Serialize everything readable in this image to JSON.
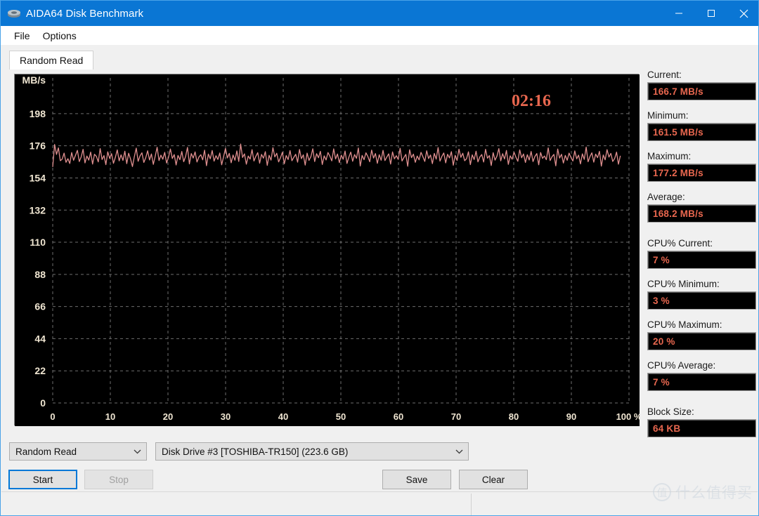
{
  "window": {
    "title": "AIDA64 Disk Benchmark",
    "icon": "disk-drive-icon",
    "minimize_label": "─",
    "maximize_label": "□",
    "close_label": "✕"
  },
  "menu": {
    "items": [
      {
        "label": "File"
      },
      {
        "label": "Options"
      }
    ]
  },
  "tabs": [
    {
      "label": "Random Read",
      "selected": true
    }
  ],
  "chart_data": {
    "type": "line",
    "title": "",
    "timer": "02:16",
    "xlabel": "",
    "ylabel": "MB/s",
    "x_unit": "%",
    "xlim": [
      0,
      100
    ],
    "ylim": [
      0,
      209
    ],
    "x_ticks": [
      0,
      10,
      20,
      30,
      40,
      50,
      60,
      70,
      80,
      90,
      100
    ],
    "x_tick_labels": [
      "0",
      "10",
      "20",
      "30",
      "40",
      "50",
      "60",
      "70",
      "80",
      "90",
      "100 %"
    ],
    "y_ticks": [
      0,
      22,
      44,
      66,
      88,
      110,
      132,
      154,
      176,
      198
    ],
    "y_tick_labels": [
      "0",
      "22",
      "44",
      "66",
      "88",
      "110",
      "132",
      "154",
      "176",
      "198"
    ],
    "grid": true,
    "grid_style": "dashed",
    "background_color": "#000000",
    "grid_color": "#6e6e6e",
    "tick_label_color": "#f0e6d2",
    "series": [
      {
        "name": "Random Read",
        "color": "#e09090",
        "unit": "MB/s",
        "x_end_percent": 98.5,
        "values": [
          161.5,
          176.9,
          170.1,
          174.6,
          165.8,
          166.9,
          171.0,
          164.7,
          167.2,
          163.9,
          171.4,
          166.1,
          169.5,
          172.9,
          165.2,
          168.4,
          173.6,
          164.3,
          169.0,
          166.2,
          171.7,
          163.5,
          170.2,
          168.8,
          165.0,
          174.1,
          166.6,
          169.3,
          163.1,
          171.9,
          167.4,
          170.6,
          164.0,
          168.1,
          173.2,
          165.7,
          169.8,
          166.0,
          172.3,
          163.8,
          170.9,
          167.0,
          161.8,
          168.6,
          174.4,
          165.4,
          169.1,
          171.2,
          164.6,
          167.8,
          172.6,
          166.3,
          170.4,
          163.3,
          168.9,
          175.0,
          165.9,
          169.6,
          166.8,
          171.5,
          164.2,
          168.2,
          173.8,
          167.3,
          170.0,
          162.9,
          169.4,
          166.5,
          172.1,
          165.1,
          168.7,
          174.9,
          163.6,
          170.7,
          167.6,
          171.8,
          164.9,
          168.3,
          169.9,
          166.4,
          173.0,
          162.4,
          170.3,
          167.1,
          172.8,
          165.5,
          169.2,
          166.7,
          171.1,
          163.0,
          168.5,
          174.2,
          167.7,
          170.8,
          164.4,
          169.7,
          166.1,
          172.5,
          165.3,
          177.2,
          168.0,
          170.5,
          163.4,
          169.0,
          166.9,
          173.4,
          165.6,
          168.8,
          171.3,
          164.1,
          170.1,
          167.5,
          172.0,
          162.6,
          169.5,
          166.2,
          174.7,
          168.4,
          170.9,
          165.0,
          167.9,
          171.6,
          163.7,
          169.3,
          166.6,
          172.7,
          165.8,
          168.1,
          170.2,
          164.8,
          173.5,
          167.2,
          169.8,
          162.8,
          171.0,
          166.0,
          168.6,
          174.0,
          165.2,
          170.6,
          167.8,
          172.2,
          163.2,
          169.1,
          166.3,
          171.4,
          168.9,
          165.7,
          173.9,
          167.0,
          170.4,
          164.5,
          169.6,
          166.8,
          172.4,
          163.9,
          168.2,
          171.7,
          165.4,
          170.0,
          167.4,
          174.5,
          162.2,
          169.4,
          166.5,
          171.2,
          168.7,
          165.1,
          173.1,
          167.6,
          170.7,
          164.0,
          169.9,
          166.1,
          172.9,
          165.9,
          168.3,
          170.5,
          163.5,
          171.8,
          167.1,
          169.2,
          166.7,
          174.3,
          165.6,
          168.0,
          170.1,
          162.0,
          173.3,
          167.9,
          170.3,
          164.7,
          169.0,
          166.4,
          171.5,
          168.5,
          165.3,
          172.6,
          167.3,
          169.7,
          163.8,
          170.8,
          166.9,
          174.8,
          165.5,
          168.8,
          171.1,
          164.3,
          170.2,
          167.7,
          172.0,
          162.7,
          169.5,
          166.0,
          173.7,
          168.1,
          170.9,
          165.8,
          167.2,
          171.9,
          163.1,
          169.8,
          166.6,
          172.3,
          165.0,
          168.4,
          170.0,
          164.9,
          173.6,
          167.5,
          169.3,
          162.5,
          171.3,
          166.2,
          168.9,
          174.1,
          165.7,
          170.6,
          167.0,
          172.8,
          163.3,
          169.1,
          166.8,
          171.6,
          168.2,
          165.4,
          173.2,
          167.8,
          170.4,
          164.6,
          169.9,
          166.3,
          172.1,
          165.2,
          168.7,
          170.7,
          163.0,
          171.4,
          167.4,
          169.0,
          166.5,
          174.6,
          165.9,
          168.5,
          170.1,
          162.3,
          173.8,
          167.6,
          170.2,
          164.2,
          169.4,
          166.1,
          171.0,
          168.0,
          165.6,
          172.5,
          167.1,
          169.6,
          163.6,
          170.5,
          166.7,
          175.1,
          165.1,
          168.6,
          171.2,
          164.8,
          170.3,
          167.9,
          172.2,
          162.1,
          169.7,
          166.4,
          173.4,
          168.3,
          170.8,
          165.3,
          167.3,
          171.7,
          163.4,
          169.2
        ]
      }
    ]
  },
  "stats": [
    {
      "label": "Current:",
      "value": "166.7 MB/s",
      "gap_after": false
    },
    {
      "label": "Minimum:",
      "value": "161.5 MB/s",
      "gap_after": false
    },
    {
      "label": "Maximum:",
      "value": "177.2 MB/s",
      "gap_after": false
    },
    {
      "label": "Average:",
      "value": "168.2 MB/s",
      "gap_after": true
    },
    {
      "label": "CPU% Current:",
      "value": "7 %",
      "gap_after": false
    },
    {
      "label": "CPU% Minimum:",
      "value": "3 %",
      "gap_after": false
    },
    {
      "label": "CPU% Maximum:",
      "value": "20 %",
      "gap_after": false
    },
    {
      "label": "CPU% Average:",
      "value": "7 %",
      "gap_after": true
    },
    {
      "label": "Block Size:",
      "value": "64 KB",
      "gap_after": false
    }
  ],
  "controls": {
    "mode_select": {
      "value": "Random Read"
    },
    "drive_select": {
      "value": "Disk Drive #3  [TOSHIBA-TR150]  (223.6 GB)"
    },
    "start_label": "Start",
    "stop_label": "Stop",
    "save_label": "Save",
    "clear_label": "Clear"
  },
  "watermark": {
    "badge": "值",
    "text": "什么值得买"
  },
  "colors": {
    "accent": "#0a76d4",
    "focus": "#0078d7",
    "value_text": "#e8674f",
    "trace": "#e09090"
  }
}
